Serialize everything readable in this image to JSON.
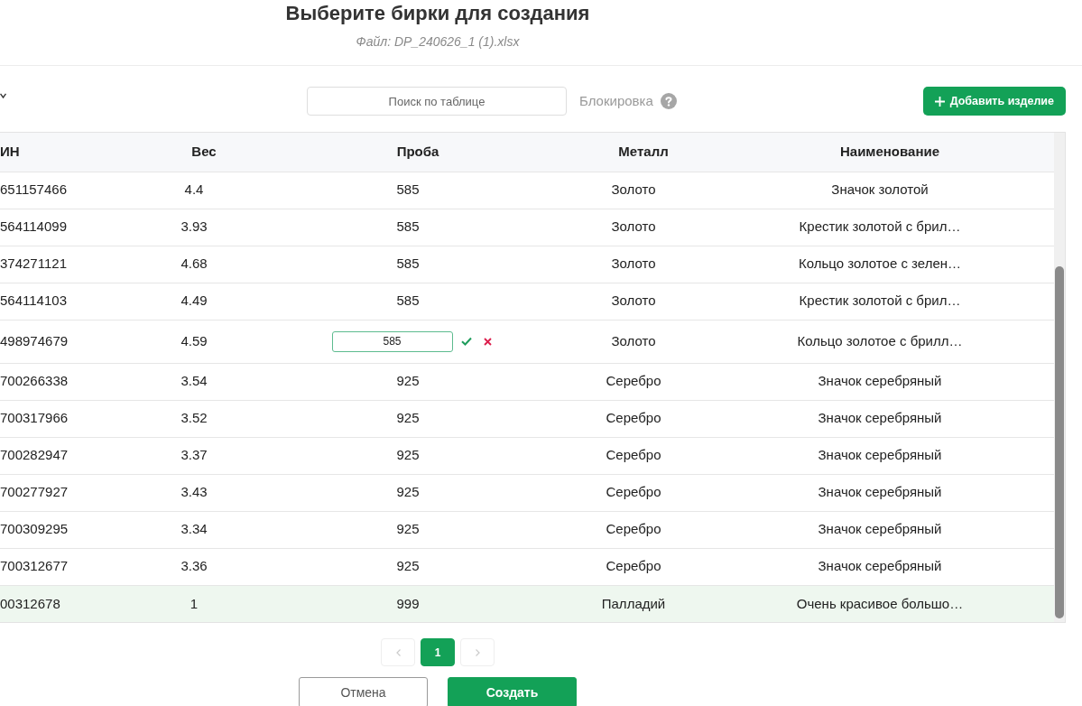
{
  "header": {
    "title": "Выберите бирки для создания",
    "subtitle": "Файл: DP_240626_1 (1).xlsx"
  },
  "toolbar": {
    "search": {
      "placeholder": "Поиск по таблице"
    },
    "lock_label": "Блокировка",
    "add_button": "Добавить изделие"
  },
  "table": {
    "columns": [
      "ИН",
      "Вес",
      "Проба",
      "Металл",
      "Наименование"
    ],
    "rows": [
      {
        "selected": false,
        "cells": [
          "651157466",
          "4.4",
          "585",
          "Золото",
          "Значок золотой"
        ]
      },
      {
        "selected": false,
        "cells": [
          "564114099",
          "3.93",
          "585",
          "Золото",
          "Крестик золотой с брил…"
        ]
      },
      {
        "selected": false,
        "cells": [
          "374271121",
          "4.68",
          "585",
          "Золото",
          "Кольцо золотое с зелен…"
        ]
      },
      {
        "selected": false,
        "cells": [
          "564114103",
          "4.49",
          "585",
          "Золото",
          "Крестик золотой с брил…"
        ]
      },
      {
        "selected": false,
        "cells": [
          "498974679",
          "4.59",
          {
            "kind": "input",
            "value": "585"
          },
          "Золото",
          "Кольцо золотое с брилл…"
        ]
      },
      {
        "selected": false,
        "cells": [
          "700266338",
          "3.54",
          "925",
          "Серебро",
          "Значок серебряный"
        ]
      },
      {
        "selected": false,
        "cells": [
          "700317966",
          "3.52",
          "925",
          "Серебро",
          "Значок серебряный"
        ]
      },
      {
        "selected": false,
        "cells": [
          "700282947",
          "3.37",
          "925",
          "Серебро",
          "Значок серебряный"
        ]
      },
      {
        "selected": false,
        "cells": [
          "700277927",
          "3.43",
          "925",
          "Серебро",
          "Значок серебряный"
        ]
      },
      {
        "selected": false,
        "cells": [
          "700309295",
          "3.34",
          "925",
          "Серебро",
          "Значок серебряный"
        ]
      },
      {
        "selected": false,
        "cells": [
          "700312677",
          "3.36",
          "925",
          "Серебро",
          "Значок серебряный"
        ]
      },
      {
        "selected": true,
        "cells": [
          "00312678",
          "1",
          "999",
          "Палладий",
          "Очень красивое большо…"
        ]
      }
    ]
  },
  "pagination": {
    "prev": {
      "disabled": true
    },
    "pages": [
      {
        "label": "1",
        "selected": true
      }
    ],
    "next": {
      "disabled": true
    }
  },
  "footer": {
    "buttons": [
      {
        "label": "Отмена",
        "kind": "secondary"
      },
      {
        "label": "Создать",
        "kind": "primary"
      }
    ]
  }
}
